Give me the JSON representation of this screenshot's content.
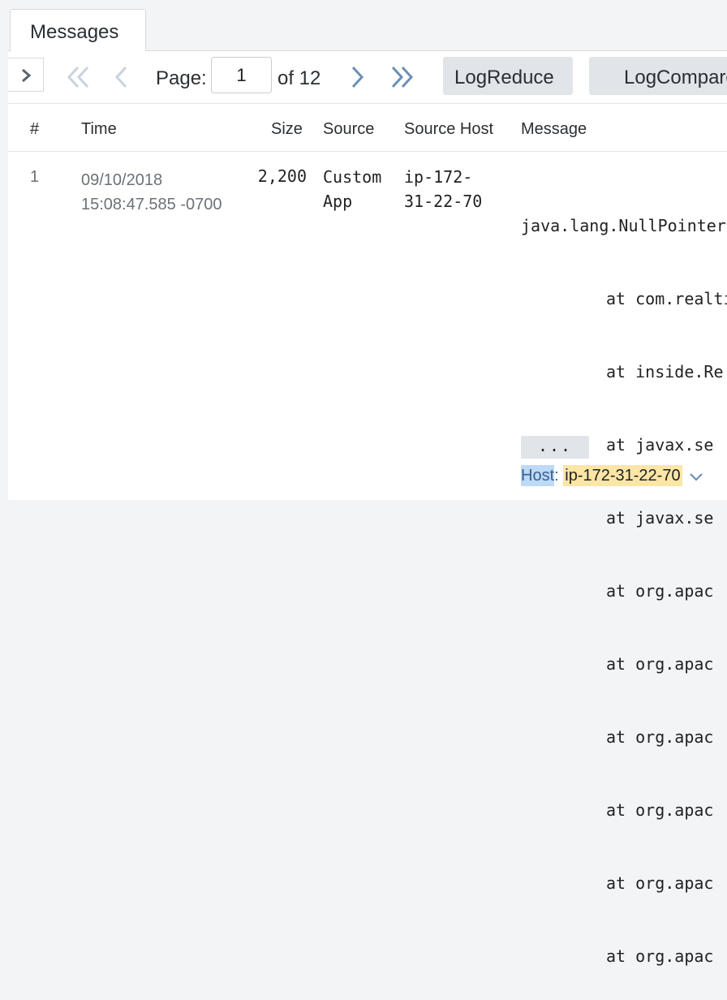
{
  "tabs": [
    {
      "label": "Messages"
    }
  ],
  "toolbar": {
    "page_label": "Page:",
    "page_value": "1",
    "of_label": "of 12",
    "logreduce_label": "LogReduce",
    "logcompare_label": "LogCompare"
  },
  "table": {
    "columns": [
      "#",
      "Time",
      "Size",
      "Source",
      "Source Host",
      "Message"
    ],
    "rows": [
      {
        "num": "1",
        "time_date": "09/10/2018",
        "time_clock": "15:08:47.585 -0700",
        "size": "2,200",
        "source_line1": "Custom",
        "source_line2": "App",
        "host_line1": "ip-172-",
        "host_line2": "31-22-70",
        "message_lines": [
          "java.lang.NullPointerException",
          "at com.realtime",
          "at inside.Re",
          "at javax.se",
          "at javax.se",
          "at org.apac",
          "at org.apac",
          "at org.apac",
          "at org.apac",
          "at org.apac",
          "at org.apac"
        ],
        "more_label": "...",
        "meta_key": "Host",
        "meta_sep": ":",
        "meta_value": "ip-172-31-22-70"
      }
    ]
  },
  "icons": {
    "expand": "chevron-right-icon",
    "first": "double-chevron-left-icon",
    "prev": "chevron-left-icon",
    "next": "chevron-right-icon",
    "last": "double-chevron-right-icon",
    "meta_toggle": "chevron-down-icon"
  },
  "colors": {
    "nav_enabled": "#6b8fb5",
    "nav_disabled": "#c9d3dd",
    "meta_key_bg": "#bcd9f7",
    "meta_value_bg": "#fbe6a6"
  }
}
